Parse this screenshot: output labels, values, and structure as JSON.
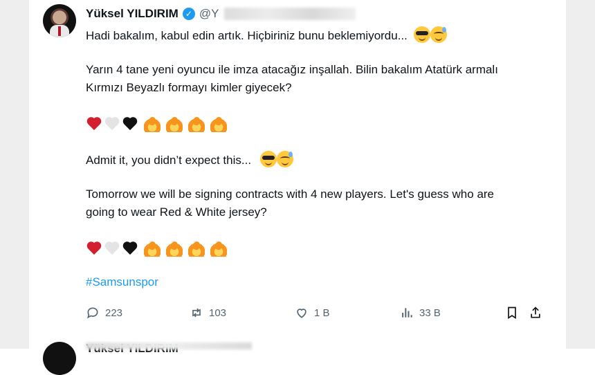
{
  "tweet": {
    "author_name": "Yüksel YILDIRIM",
    "handle": "@Y",
    "paragraphs": [
      "Hadi bakalım, kabul edin artık. Hiçbiriniz bunu beklemiyordu...",
      "Yarın 4 tane yeni oyuncu ile imza atacağız inşallah. Bilin bakalım Atatürk armalı",
      "Kırmızı Beyazlı formayı kimler  giyecek?",
      "Admit it, you didn’t expect this...",
      "Tomorrow we will be signing contracts with 4 new players. Let's guess who are",
      "going to wear Red & White jersey?"
    ],
    "emoji_rows": [
      [
        "red-heart",
        "white-heart",
        "black-heart",
        "fire",
        "fire",
        "fire",
        "fire"
      ],
      [
        "red-heart",
        "white-heart",
        "black-heart",
        "fire",
        "fire",
        "fire",
        "fire"
      ]
    ],
    "emoji_inline": [
      "smiling-face-with-sunglasses",
      "grinning-face-with-sweat"
    ],
    "hashtag": "#Samsunspor",
    "stats": {
      "replies": "223",
      "reposts": "103",
      "likes": "1 B",
      "views": "33 B"
    },
    "icons": [
      "reply-icon",
      "repost-icon",
      "like-icon",
      "views-icon",
      "bookmark-icon",
      "share-icon"
    ]
  },
  "next_tweet": {
    "author_name": "Yüksel YILDIRIM"
  },
  "colors": {
    "link": "#1d9bf0",
    "verified": "#1d9bf0",
    "secondary_text": "#536471"
  }
}
